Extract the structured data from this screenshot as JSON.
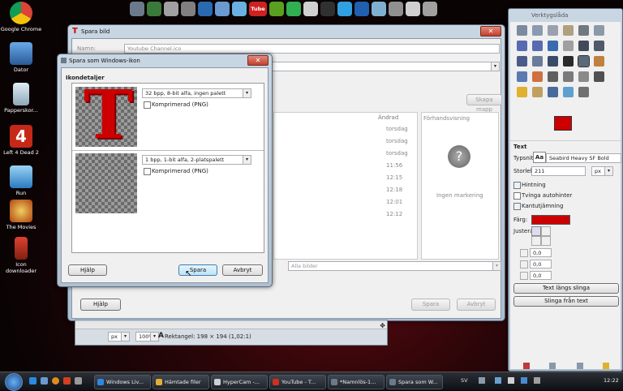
{
  "desktop_icons": [
    {
      "label": "Google Chrome",
      "color": "#e04a3a"
    },
    {
      "label": "Dator",
      "color": "#4a88d0"
    },
    {
      "label": "Papperskor...",
      "color": "#9fb8c8"
    },
    {
      "label": "Left 4 Dead 2",
      "color": "#d03020"
    },
    {
      "label": "Run",
      "color": "#3aa0e0"
    },
    {
      "label": "The Movies",
      "color": "#c0a040"
    },
    {
      "label": "Icon downloader",
      "color": "#cc3322"
    }
  ],
  "dock_icons": [
    "#6a7a8a",
    "#3a7a3a",
    "#a0a0a0",
    "#808080",
    "#2a6ab0",
    "#6a9ad0",
    "#6ab0e0",
    "#d02020",
    "#5aa020",
    "#30b050",
    "#d0d0d0",
    "#303030",
    "#30a0e0",
    "#2060b0",
    "#80b0d0",
    "#909090",
    "#d0d0d0",
    "#a0a0a0"
  ],
  "youtube_label": "Tube",
  "bg_dialog": {
    "title": "Spara bild",
    "name_label": "Namn:",
    "name_value": "Youtube Channel.ico",
    "browse_button": "Skapa mapp",
    "col_modified": "Ändrad",
    "dates": [
      "torsdag",
      "torsdag",
      "torsdag",
      "11:56",
      "12:15",
      "12:18",
      "12:01",
      "12:12"
    ],
    "preview_label": "Förhandsvisning",
    "no_selection": "Ingen markering",
    "filter": "Alla bilder",
    "help": "Hjälp",
    "save": "Spara",
    "cancel": "Avbryt"
  },
  "ico_dialog": {
    "title": "Spara som Windows-ikon",
    "section": "Ikondetaljer",
    "layer1_format": "32 bpp, 8-bit alfa, ingen palett",
    "layer1_compress": "Komprimerad (PNG)",
    "layer2_format": "1 bpp, 1-bit alfa, 2-platspalett",
    "layer2_compress": "Komprimerad (PNG)",
    "help": "Hjälp",
    "save": "Spara",
    "cancel": "Avbryt",
    "letter": "T"
  },
  "image_status": {
    "unit": "px",
    "zoom": "100%",
    "info": "Rektangel: 198 × 194 (1,02:1)"
  },
  "toolbox": {
    "title": "Verktygslåda",
    "tool_colors": [
      "#7a8aa0",
      "#8a9ab0",
      "#9aa0b0",
      "#b0a080",
      "#707880",
      "#8a9aa8",
      "#5a6ab0",
      "#5a6ab0",
      "#3a6ab0",
      "#a0a0a0",
      "#404a5a",
      "#505a6a",
      "#4a5a8a",
      "#6a7a9a",
      "#3a4a6a",
      "#2a2a2a",
      "#5a6a7a",
      "#c08040",
      "#5a7ab0",
      "#d07040",
      "#606060",
      "#7a7a7a",
      "#8a8a8a",
      "#505050",
      "#e0b030",
      "#c0a060",
      "#4a6a9a",
      "#60a0d0",
      "#707070"
    ],
    "fg_color": "#cc0000",
    "text_section": "Text",
    "font_label": "Typsnitt",
    "font_value": "Seabird Heavy SF Bold",
    "size_label": "Storlek:",
    "size_value": "211",
    "size_unit": "px",
    "hinting": "Hintning",
    "force_autohint": "Tvinga autohinter",
    "antialias": "Kantutjämning",
    "color_label": "Färg:",
    "text_color": "#cc0000",
    "justify_label": "Justera:",
    "indent": "0,0",
    "line_spacing": "0,0",
    "letter_spacing": "0,0",
    "btn_text_along_path": "Text längs slinga",
    "btn_path_from_text": "Slinga från text"
  },
  "taskbar": {
    "items": [
      "Windows Liv...",
      "Hämtade filer",
      "HyperCam -...",
      "YouTube - T...",
      "*Namnlös-1...",
      "Spara som W..."
    ],
    "lang": "SV",
    "time": "12:22"
  }
}
